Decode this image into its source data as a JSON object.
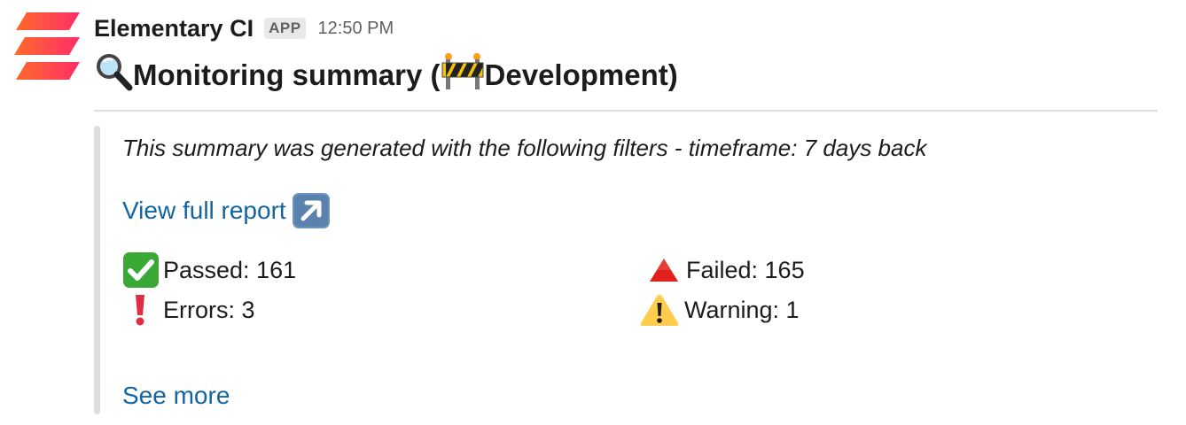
{
  "message": {
    "sender": "Elementary CI",
    "app_badge": "APP",
    "timestamp": "12:50 PM",
    "avatar_icon": "elementary-logo-icon",
    "brand_colors": [
      "#ff2d55",
      "#ff6a2a",
      "#ffa13a"
    ]
  },
  "title": {
    "prefix": "Monitoring summary (",
    "suffix": " Development)",
    "prefix_icon": "magnifying-glass-icon",
    "env_icon": "construction-barrier-icon"
  },
  "filters_text": "This summary was generated with the following filters - timeframe: 7 days back",
  "report": {
    "label": "View full report",
    "icon": "arrow-up-right-icon",
    "link_color": "#1264a3"
  },
  "stats": {
    "passed": {
      "label": "Passed: 161",
      "icon": "check-mark-button-icon",
      "color": "#3aa835"
    },
    "failed": {
      "label": "Failed: 165",
      "icon": "red-triangle-icon",
      "color": "#e0201b"
    },
    "errors": {
      "label": "Errors: 3",
      "icon": "exclamation-mark-icon",
      "color": "#dd2e44"
    },
    "warning": {
      "label": "Warning: 1",
      "icon": "warning-sign-icon",
      "color": "#ffcc4d"
    }
  },
  "see_more": "See more"
}
